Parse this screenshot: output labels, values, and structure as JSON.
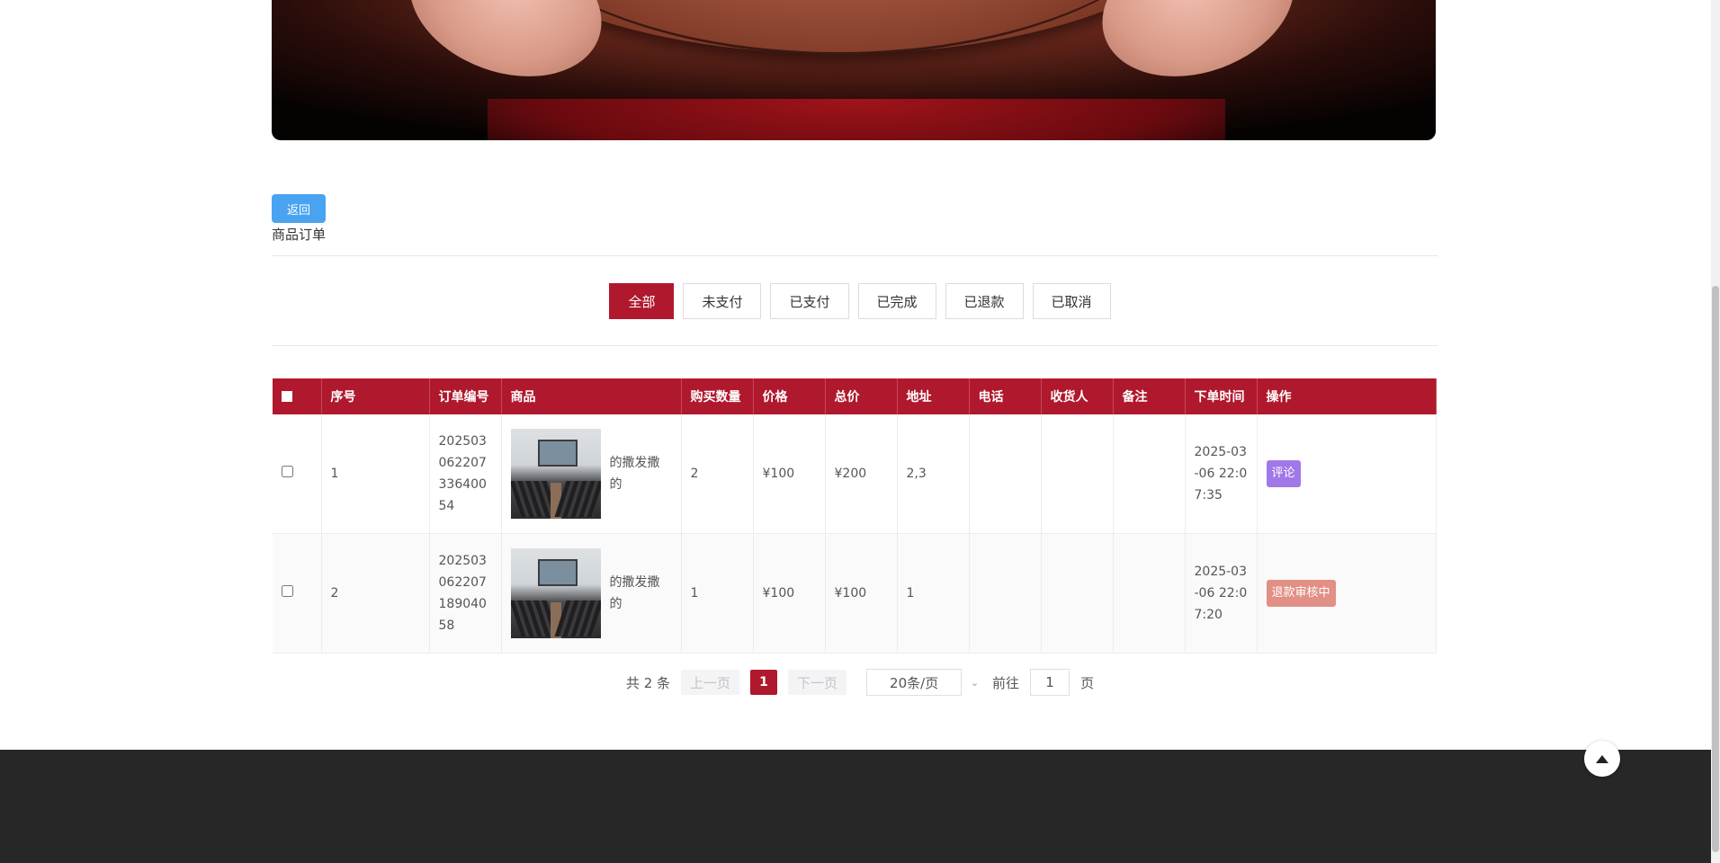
{
  "back_label": "返回",
  "title": "商品订单",
  "tabs": [
    "全部",
    "未支付",
    "已支付",
    "已完成",
    "已退款",
    "已取消"
  ],
  "table": {
    "headers": [
      "序号",
      "订单编号",
      "商品",
      "购买数量",
      "价格",
      "总价",
      "地址",
      "电话",
      "收货人",
      "备注",
      "下单时间",
      "操作"
    ],
    "rows": [
      {
        "index": "1",
        "order_no": "20250306220733640054",
        "goods_name": "的撒发撒的",
        "quantity": "2",
        "price": "¥100",
        "total": "¥200",
        "address": "2,3",
        "phone": "",
        "receiver": "",
        "remark": "",
        "time": "2025-03-06 22:07:35",
        "action": "评论"
      },
      {
        "index": "2",
        "order_no": "20250306220718904058",
        "goods_name": "的撒发撒的",
        "quantity": "1",
        "price": "¥100",
        "total": "¥100",
        "address": "1",
        "phone": "",
        "receiver": "",
        "remark": "",
        "time": "2025-03-06 22:07:20",
        "action": "退款审核中"
      }
    ]
  },
  "pagination": {
    "total_text": "共 2 条",
    "prev": "上一页",
    "current": "1",
    "next": "下一页",
    "page_size": "20条/页",
    "goto_label": "前往",
    "goto_value": "1",
    "page_suffix": "页"
  },
  "colors": {
    "accent": "#b0182d",
    "back_button": "#4aa3f0",
    "review_badge": "#a178e8",
    "refund_badge": "#e28f86",
    "footer": "#272727"
  },
  "icons": {
    "back_to_top": "triangle-up-icon",
    "select_arrow": "chevron-down-icon"
  }
}
